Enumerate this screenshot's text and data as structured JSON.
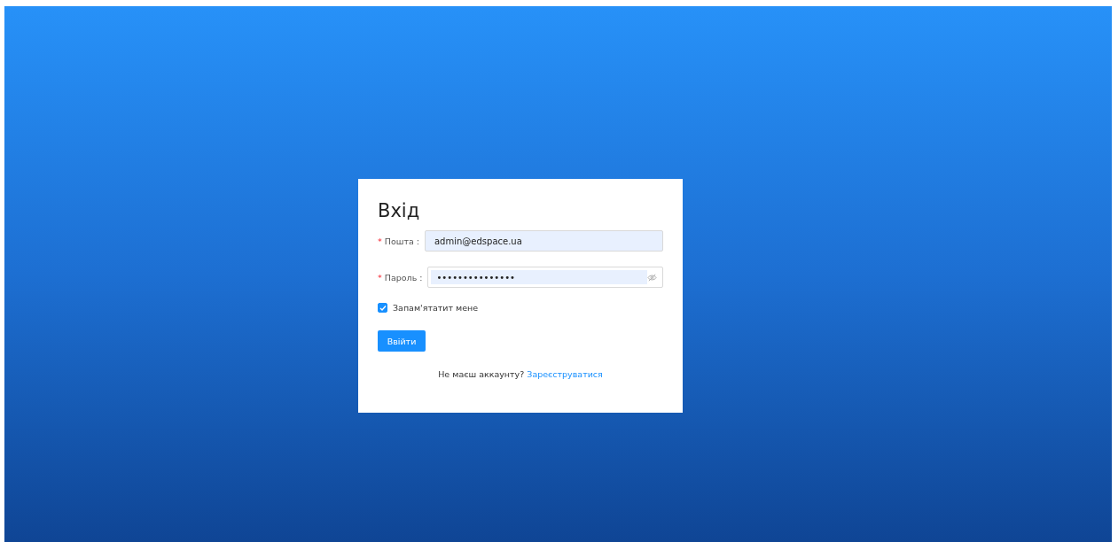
{
  "login_form": {
    "title": "Вхід",
    "fields": [
      {
        "label": "Пошта :",
        "required_mark": "*",
        "kind": "text",
        "value": "admin@edspace.ua"
      },
      {
        "label": "Пароль :",
        "required_mark": "*",
        "kind": "password",
        "value": "•••••••••••••••"
      }
    ],
    "remember": {
      "label": "Запам'ятатит мене",
      "checked": true
    },
    "submit": "Ввійти",
    "footer": {
      "text": "Не маєш аккаунту?",
      "link": "Зареєструватися"
    }
  }
}
